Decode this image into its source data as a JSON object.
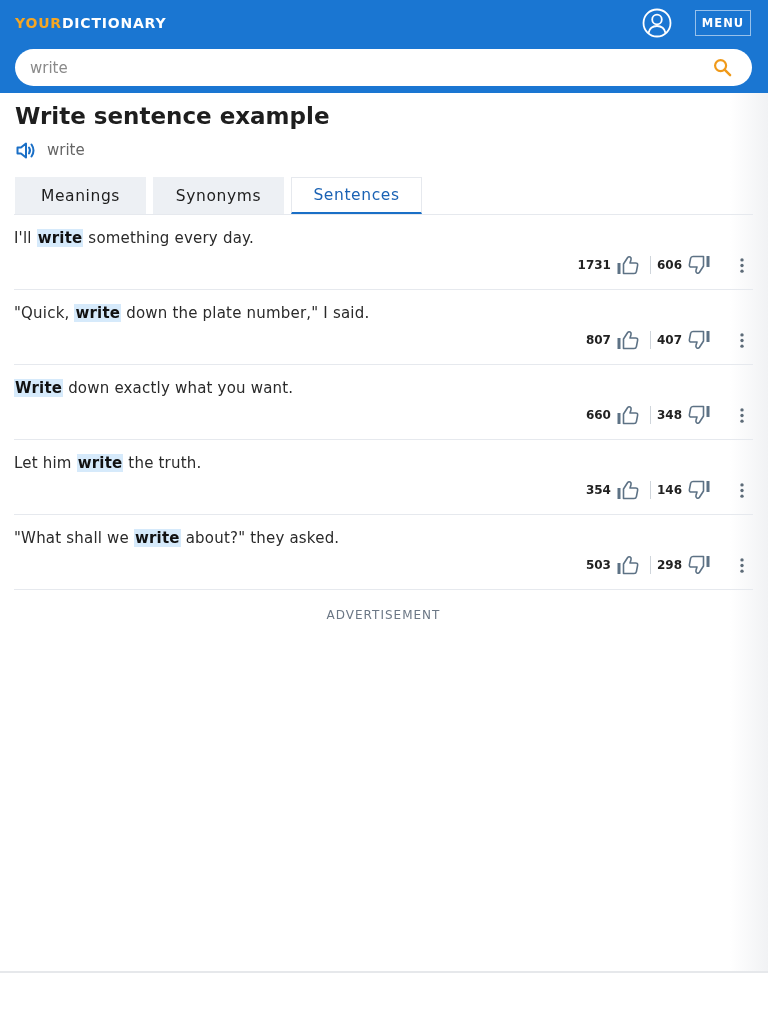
{
  "header": {
    "logo": {
      "accent": "YOUR",
      "rest": "DICTIONARY"
    },
    "menu_button": "MENU",
    "search": {
      "value": "write"
    }
  },
  "heading": {
    "title": "Write sentence example",
    "pronunciation": "write"
  },
  "tabs": [
    {
      "label": "Meanings",
      "selected": false
    },
    {
      "label": "Synonyms",
      "selected": false
    },
    {
      "label": "Sentences",
      "selected": true
    }
  ],
  "sentences": [
    {
      "text": "I'll **write** something every day.",
      "upvotes": "1731",
      "downvotes": "606"
    },
    {
      "text": "\"Quick, **write** down the plate number,\" I said.",
      "upvotes": "807",
      "downvotes": "407"
    },
    {
      "text": "**Write** down exactly what you want.",
      "upvotes": "660",
      "downvotes": "348"
    },
    {
      "text": "Let him **write** the truth.",
      "upvotes": "354",
      "downvotes": "146"
    },
    {
      "text": "\"What shall we **write** about?\" they asked.",
      "upvotes": "503",
      "downvotes": "298"
    }
  ],
  "advertisement_label": "ADVERTISEMENT"
}
